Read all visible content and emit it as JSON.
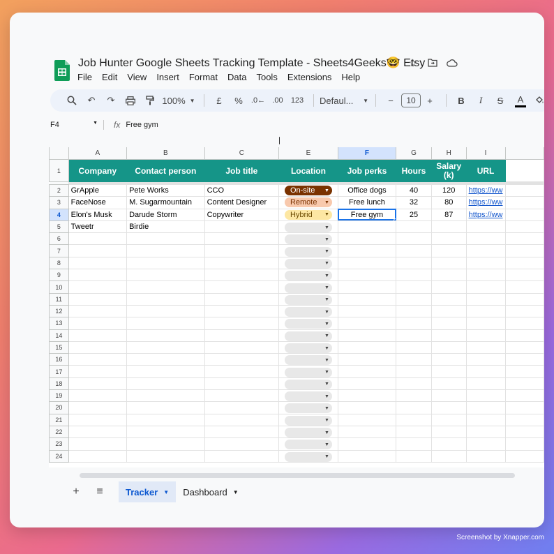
{
  "app": {
    "title": "Job Hunter Google Sheets Tracking Template - Sheets4Geeks🤓 Etsy",
    "menu": [
      "File",
      "Edit",
      "View",
      "Insert",
      "Format",
      "Data",
      "Tools",
      "Extensions",
      "Help"
    ]
  },
  "toolbar": {
    "zoom": "100%",
    "currency": "£",
    "percent": "%",
    "dec_decrease": ".0←",
    "dec_increase": ".00",
    "number_format": "123",
    "font": "Defaul...",
    "font_size": "10",
    "minus": "−",
    "plus": "+",
    "bold": "B",
    "italic": "I",
    "text_color": "A"
  },
  "formula_bar": {
    "cell_ref": "F4",
    "fx": "fx",
    "content": "Free gym"
  },
  "columns": [
    "A",
    "B",
    "C",
    "E",
    "F",
    "G",
    "H",
    "I"
  ],
  "selected_column": "F",
  "selected_row": "4",
  "headers": [
    "Company",
    "Contact person",
    "Job title",
    "Location",
    "Job perks",
    "Hours",
    "Salary (k)",
    "URL"
  ],
  "rows": [
    {
      "num": "2",
      "company": "GrApple",
      "contact": "Pete Works",
      "job": "CCO",
      "location": "On-site",
      "perks": "Office dogs",
      "hours": "40",
      "salary": "120",
      "url": "https://ww"
    },
    {
      "num": "3",
      "company": "FaceNose",
      "contact": "M. Sugarmountain",
      "job": "Content Designer",
      "location": "Remote",
      "perks": "Free lunch",
      "hours": "32",
      "salary": "80",
      "url": "https://ww"
    },
    {
      "num": "4",
      "company": "Elon's Musk",
      "contact": "Darude Storm",
      "job": "Copywriter",
      "location": "Hybrid",
      "perks": "Free gym",
      "hours": "25",
      "salary": "87",
      "url": "https://ww"
    },
    {
      "num": "5",
      "company": "Tweetr",
      "contact": "Birdie",
      "job": "",
      "location": "",
      "perks": "",
      "hours": "",
      "salary": "",
      "url": ""
    }
  ],
  "empty_rows": [
    "6",
    "7",
    "8",
    "9",
    "10",
    "11",
    "12",
    "13",
    "14",
    "15",
    "16",
    "17",
    "18",
    "19",
    "20",
    "21",
    "22",
    "23",
    "24"
  ],
  "location_colors": {
    "On-site": {
      "bg": "#7a3200",
      "fg": "#ffffff"
    },
    "Remote": {
      "bg": "#f8c9ad",
      "fg": "#7a3200"
    },
    "Hybrid": {
      "bg": "#fde7a3",
      "fg": "#6b4a00"
    }
  },
  "header_color": "#159588",
  "tabs": [
    {
      "label": "Tracker",
      "active": true
    },
    {
      "label": "Dashboard",
      "active": false
    }
  ],
  "watermark": "Screenshot by Xnapper.com"
}
